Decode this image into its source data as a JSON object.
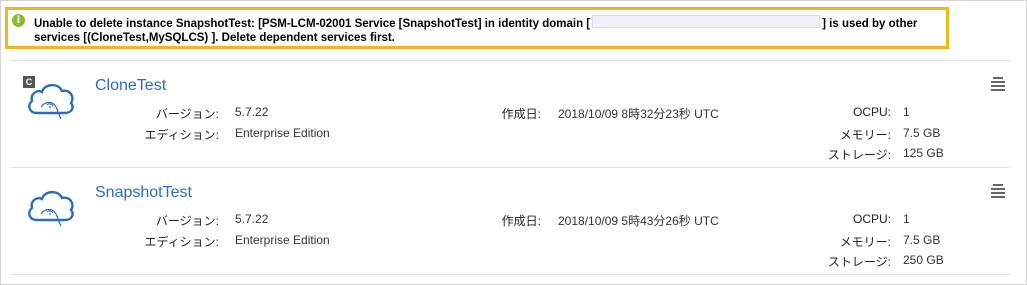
{
  "alert": {
    "text_before": "Unable to delete instance SnapshotTest: [PSM-LCM-02001 Service [SnapshotTest] in identity domain [",
    "text_after": "] is used by other services [(CloneTest,MySQLCS) ]. Delete dependent services first.",
    "icon": "info-icon",
    "icon_glyph": "i",
    "border_color": "#f0b61e"
  },
  "labels": {
    "version": "バージョン:",
    "edition": "エディション:",
    "created": "作成日:",
    "ocpu": "OCPU:",
    "memory": "メモリー:",
    "storage": "ストレージ:"
  },
  "instances": [
    {
      "name": "CloneTest",
      "clone_badge": "C",
      "version": "5.7.22",
      "edition": "Enterprise Edition",
      "created": "2018/10/09 8時32分23秒 UTC",
      "ocpu": "1",
      "memory": "7.5 GB",
      "storage": "125 GB"
    },
    {
      "name": "SnapshotTest",
      "version": "5.7.22",
      "edition": "Enterprise Edition",
      "created": "2018/10/09 5時43分26秒 UTC",
      "ocpu": "1",
      "memory": "7.5 GB",
      "storage": "250 GB"
    }
  ],
  "colors": {
    "link": "#2a6ebb",
    "icon_blue": "#2a6ebb",
    "success_green": "#8db833"
  }
}
